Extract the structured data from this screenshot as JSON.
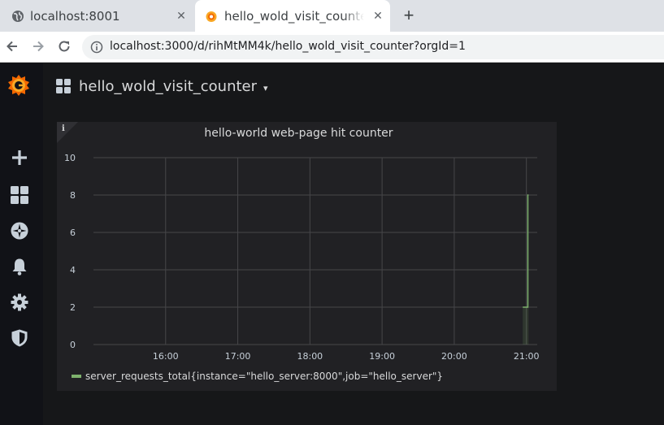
{
  "browser": {
    "tabs": [
      {
        "title": "localhost:8001",
        "active": false,
        "icon": "globe-icon"
      },
      {
        "title": "hello_wold_visit_counter",
        "active": true,
        "icon": "grafana-icon"
      }
    ],
    "close_glyph": "✕",
    "new_tab_glyph": "+",
    "url": "localhost:3000/d/rihMtMM4k/hello_wold_visit_counter?orgId=1"
  },
  "grafana": {
    "sidemenu": [
      "grafana-logo-icon",
      "plus-icon",
      "dashboards-icon",
      "explore-icon",
      "bell-icon",
      "gear-icon",
      "shield-icon"
    ],
    "dashboard_title": "hello_wold_visit_counter",
    "caret": "▾",
    "panel": {
      "info": "i",
      "title": "hello-world web-page hit counter",
      "legend": "server_requests_total{instance=\"hello_server:8000\",job=\"hello_server\"}"
    }
  },
  "colors": {
    "accent": "#f46800",
    "series": "#7eb26d",
    "panel_bg": "#212124",
    "page_bg": "#161719"
  },
  "chart_data": {
    "type": "line",
    "title": "hello-world web-page hit counter",
    "xlabel": "",
    "ylabel": "",
    "ylim": [
      0,
      10
    ],
    "y_ticks": [
      "0",
      "2",
      "4",
      "6",
      "8",
      "10"
    ],
    "x_ticks": [
      "16:00",
      "17:00",
      "18:00",
      "19:00",
      "20:00",
      "21:00"
    ],
    "x_tick_hours": [
      16,
      17,
      18,
      19,
      20,
      21
    ],
    "xlim_hours": [
      15.0,
      21.15
    ],
    "grid": true,
    "legend": "bottom-left",
    "series": [
      {
        "name": "server_requests_total{instance=\"hello_server:8000\",job=\"hello_server\"}",
        "x_hours": [
          20.95,
          21.02,
          21.02,
          21.03
        ],
        "values": [
          2,
          2,
          8,
          8
        ]
      }
    ]
  }
}
